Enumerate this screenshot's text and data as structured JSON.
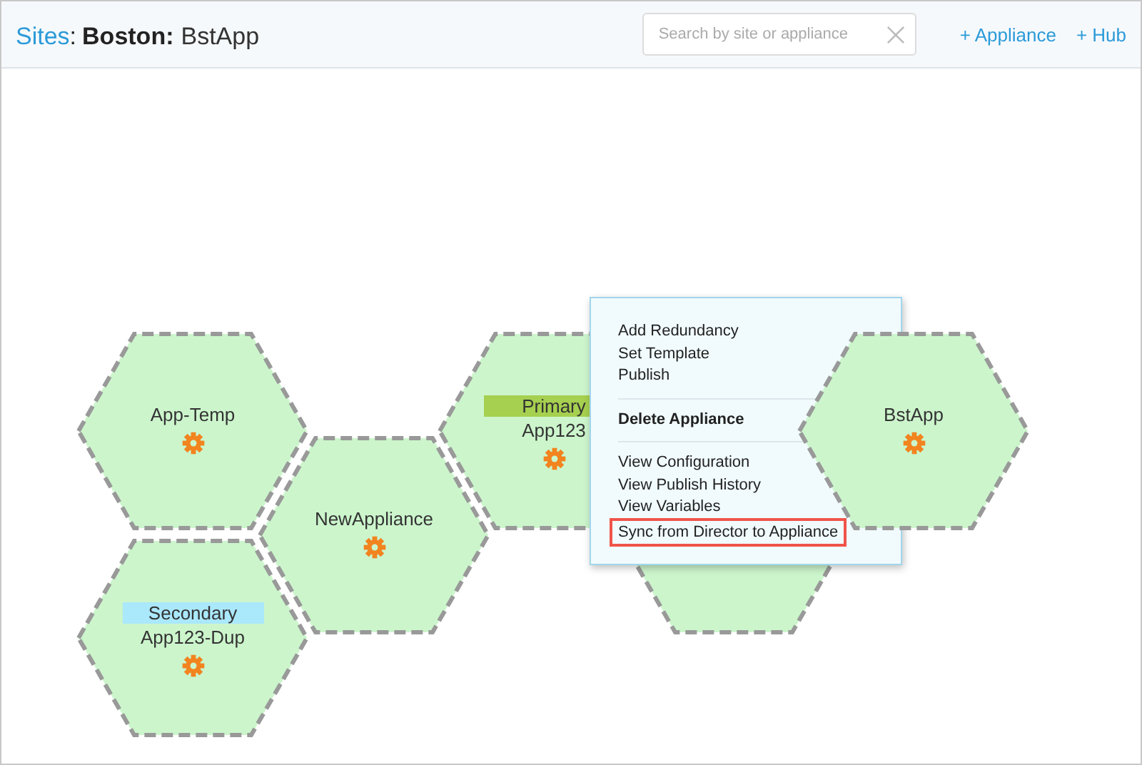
{
  "breadcrumb": {
    "link": "Sites",
    "parent": "Boston:",
    "current": "BstApp",
    "separator": ":"
  },
  "search": {
    "placeholder": "Search by site or appliance"
  },
  "actions": [
    "+ Appliance",
    "+ Hub"
  ],
  "appliances": [
    {
      "kind": "node",
      "name": "App-Temp"
    },
    {
      "kind": "node",
      "name": "NewAppliance"
    },
    {
      "kind": "node",
      "name": "App123",
      "role": {
        "label": "Primary",
        "color": "#a6d04f"
      }
    },
    {
      "kind": "node",
      "name": "App123-Dup",
      "role": {
        "label": "Secondary",
        "color": "#aae8fc"
      }
    },
    {
      "kind": "covered"
    },
    {
      "kind": "node",
      "name": "BstApp"
    }
  ],
  "menu": {
    "groups": [
      {
        "items": [
          {
            "label": "Add Redundancy",
            "emphasized": false,
            "highlighted": false
          },
          {
            "label": "Set Template",
            "emphasized": false,
            "highlighted": false
          },
          {
            "label": "Publish",
            "emphasized": false,
            "highlighted": false
          }
        ]
      },
      {
        "items": [
          {
            "label": "Delete Appliance",
            "emphasized": true,
            "highlighted": false
          }
        ]
      },
      {
        "items": [
          {
            "label": "View Configuration",
            "emphasized": false,
            "highlighted": false
          },
          {
            "label": "View Publish History",
            "emphasized": false,
            "highlighted": false
          },
          {
            "label": "View Variables",
            "emphasized": false,
            "highlighted": false
          },
          {
            "label": "Sync from Director to Appliance",
            "emphasized": false,
            "highlighted": true
          }
        ]
      }
    ]
  }
}
